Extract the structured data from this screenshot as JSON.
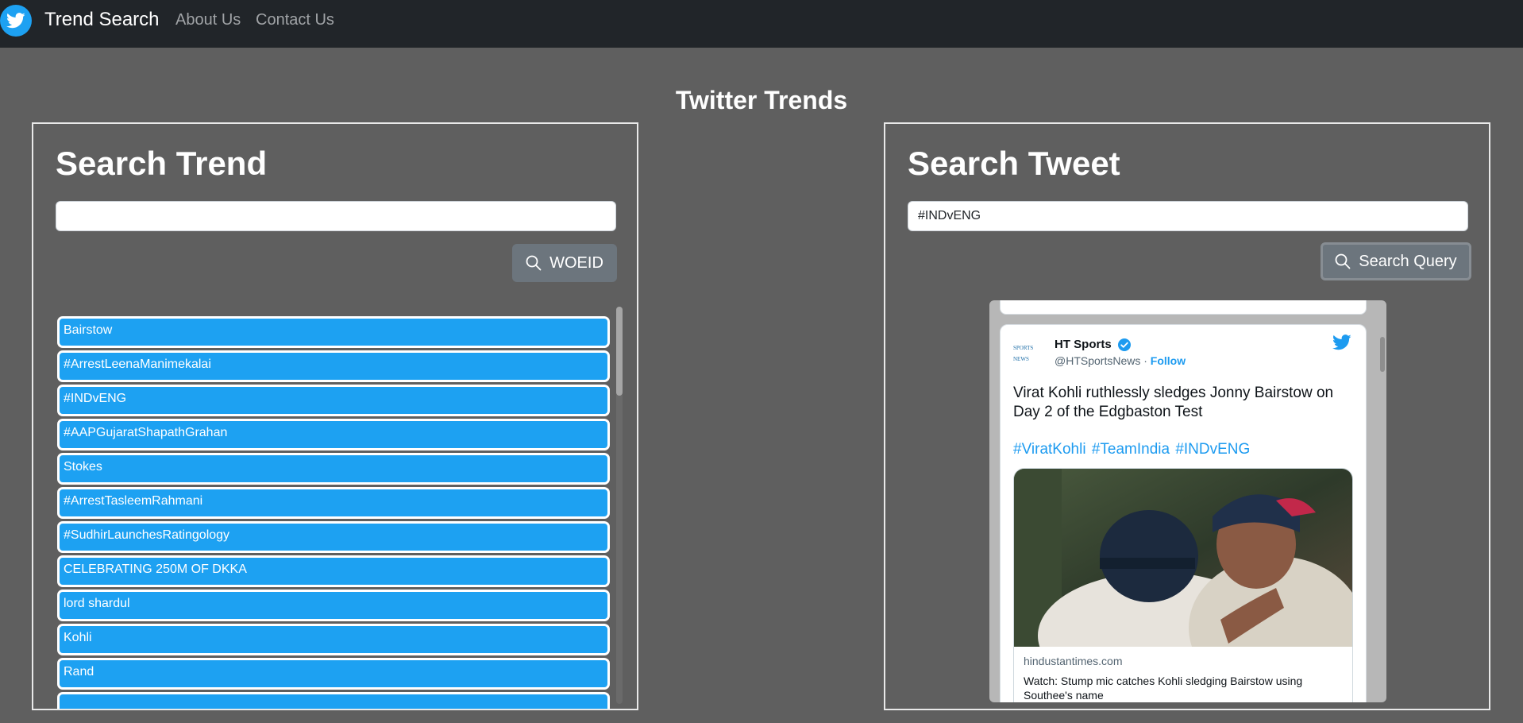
{
  "nav": {
    "brand": "Trend Search",
    "links": [
      {
        "label": "About Us"
      },
      {
        "label": "Contact Us"
      }
    ],
    "logo_icon": "twitter-bird-icon"
  },
  "page_title": "Twitter Trends",
  "search_trend": {
    "heading": "Search Trend",
    "input_value": "",
    "button_label": "WOEID",
    "button_icon": "search-icon",
    "trends": [
      "Bairstow",
      "#ArrestLeenaManimekalai",
      "#INDvENG",
      "#AAPGujaratShapathGrahan",
      "Stokes",
      "#ArrestTasleemRahmani",
      "#SudhirLaunchesRatingology",
      "CELEBRATING 250M OF DKKA",
      "lord shardul",
      "Kohli",
      "Rand",
      ""
    ]
  },
  "search_tweet": {
    "heading": "Search Tweet",
    "input_value": "#INDvENG",
    "button_label": "Search Query",
    "button_icon": "search-icon",
    "tweet": {
      "author_name": "HT Sports",
      "avatar_text": "SPORTS NEWS",
      "handle": "@HTSportsNews",
      "separator": "·",
      "follow_label": "Follow",
      "text": "Virat Kohli ruthlessly sledges Jonny Bairstow on Day 2 of the Edgbaston Test",
      "hashtags": "#ViratKohli #TeamIndia #INDvENG",
      "link_domain": "hindustantimes.com",
      "link_title": "Watch: Stump mic catches Kohli sledging Bairstow using Southee's name"
    }
  },
  "colors": {
    "page_bg": "#5f5f5f",
    "navbar_bg": "#212529",
    "trend_item_bg": "#1da1f2",
    "button_bg": "#6c757d",
    "link_blue": "#1d9bf0"
  }
}
